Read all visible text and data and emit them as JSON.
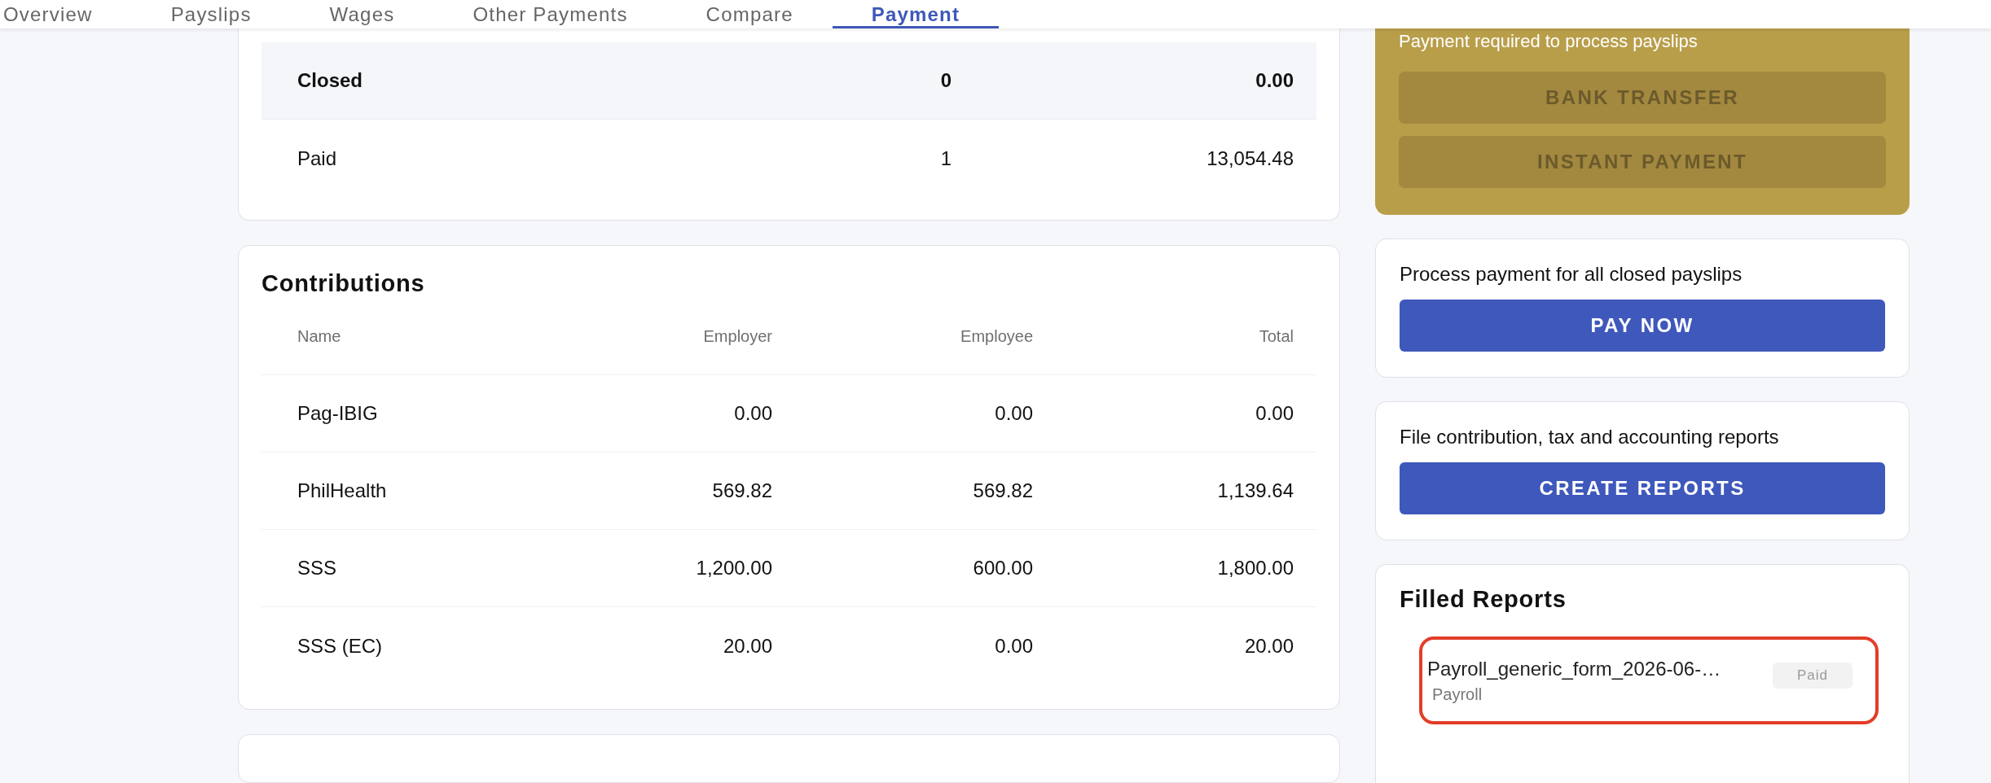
{
  "tabs": [
    {
      "label": "Overview",
      "selected": false
    },
    {
      "label": "Payslips",
      "selected": false
    },
    {
      "label": "Wages",
      "selected": false
    },
    {
      "label": "Other Payments",
      "selected": false
    },
    {
      "label": "Compare",
      "selected": false
    },
    {
      "label": "Payment",
      "selected": true
    }
  ],
  "status_table": {
    "rows": [
      {
        "status": "Closed",
        "count": "0",
        "amount": "0.00",
        "highlighted": true
      },
      {
        "status": "Paid",
        "count": "1",
        "amount": "13,054.48",
        "highlighted": false
      }
    ]
  },
  "contributions": {
    "title": "Contributions",
    "columns": [
      "Name",
      "Employer",
      "Employee",
      "Total"
    ],
    "rows": [
      [
        "Pag-IBIG",
        "0.00",
        "0.00",
        "0.00"
      ],
      [
        "PhilHealth",
        "569.82",
        "569.82",
        "1,139.64"
      ],
      [
        "SSS",
        "1,200.00",
        "600.00",
        "1,800.00"
      ],
      [
        "SSS (EC)",
        "20.00",
        "0.00",
        "20.00"
      ]
    ]
  },
  "payment_required": {
    "caption": "Payment required to process payslips",
    "buttons": [
      {
        "label": "BANK TRANSFER",
        "disabled": true
      },
      {
        "label": "INSTANT PAYMENT",
        "disabled": true
      }
    ]
  },
  "actions": [
    {
      "text": "Process payment for all closed payslips",
      "button": "PAY NOW"
    },
    {
      "text": "File contribution, tax and accounting reports",
      "button": "CREATE REPORTS"
    }
  ],
  "filled_reports": {
    "title": "Filled Reports",
    "items": [
      {
        "name": "Payroll_generic_form_2026-06-…",
        "type": "Payroll",
        "status": "Paid",
        "highlighted": true
      }
    ]
  }
}
